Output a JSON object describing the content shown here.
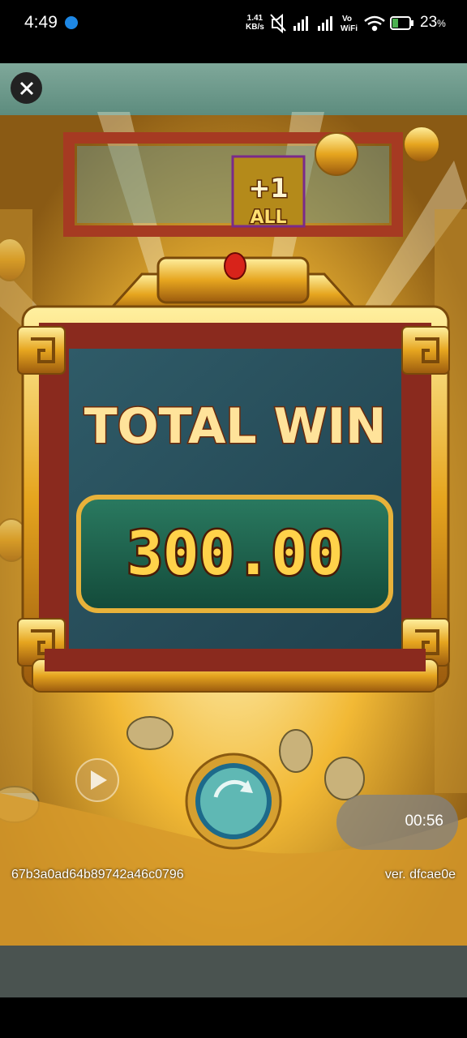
{
  "status_bar": {
    "time": "4:49",
    "net_speed_value": "1.41",
    "net_speed_unit": "KB/s",
    "vowifi_line1": "Vo",
    "vowifi_line2": "WiFi",
    "battery_percent": "23",
    "battery_unit": "%"
  },
  "game": {
    "bonus_badge_line1": "+1",
    "bonus_badge_line2": "ALL",
    "total_win_title": "TOTAL WIN",
    "total_win_amount": "300.00",
    "session_hash": "67b3a0ad64b89742a46c0796",
    "version": "ver. dfcae0e",
    "timer": "00:56"
  },
  "colors": {
    "panel_frame": "#e0a21e",
    "panel_bg": "#2e5a6a",
    "amount_box": "#1f6a55",
    "brick": "#8a2a1e"
  }
}
